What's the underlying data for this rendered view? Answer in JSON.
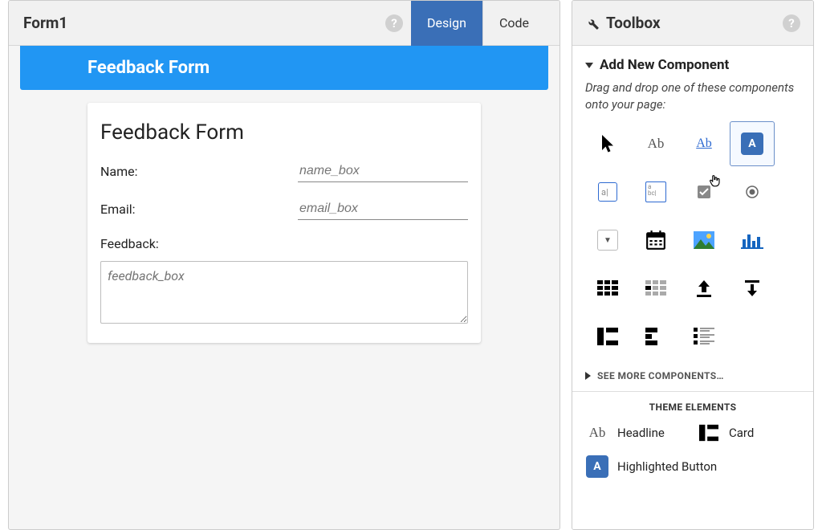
{
  "header": {
    "form_name": "Form1",
    "tabs": {
      "design": "Design",
      "code": "Code"
    }
  },
  "form": {
    "banner": "Feedback Form",
    "heading": "Feedback Form",
    "fields": {
      "name_label": "Name:",
      "name_placeholder": "name_box",
      "email_label": "Email:",
      "email_placeholder": "email_box",
      "feedback_label": "Feedback:",
      "feedback_placeholder": "feedback_box"
    }
  },
  "toolbox": {
    "title": "Toolbox",
    "section": "Add New Component",
    "hint": "Drag and drop one of these components onto your page:",
    "components": [
      {
        "id": "cursor",
        "name": "cursor-icon"
      },
      {
        "id": "label",
        "name": "label-icon",
        "text": "Ab"
      },
      {
        "id": "link",
        "name": "link-icon",
        "text": "Ab"
      },
      {
        "id": "button",
        "name": "button-icon",
        "text": "A",
        "selected": true
      },
      {
        "id": "textbox",
        "name": "textbox-icon"
      },
      {
        "id": "textarea",
        "name": "textarea-icon"
      },
      {
        "id": "checkbox",
        "name": "checkbox-icon"
      },
      {
        "id": "radio",
        "name": "radio-icon"
      },
      {
        "id": "dropdown",
        "name": "dropdown-icon"
      },
      {
        "id": "datepicker",
        "name": "datepicker-icon"
      },
      {
        "id": "image",
        "name": "image-icon"
      },
      {
        "id": "chart",
        "name": "chart-icon"
      },
      {
        "id": "grid-dense",
        "name": "grid-dense-icon"
      },
      {
        "id": "grid-light",
        "name": "grid-light-icon"
      },
      {
        "id": "upload",
        "name": "upload-icon"
      },
      {
        "id": "download-bar",
        "name": "download-bar-icon"
      },
      {
        "id": "col-left",
        "name": "column-left-icon"
      },
      {
        "id": "col-right",
        "name": "column-right-icon"
      },
      {
        "id": "list",
        "name": "list-icon"
      }
    ],
    "see_more": "SEE MORE COMPONENTS…",
    "theme_title": "THEME ELEMENTS",
    "theme": {
      "headline": "Headline",
      "card": "Card",
      "highlighted_button": "Highlighted Button"
    }
  }
}
